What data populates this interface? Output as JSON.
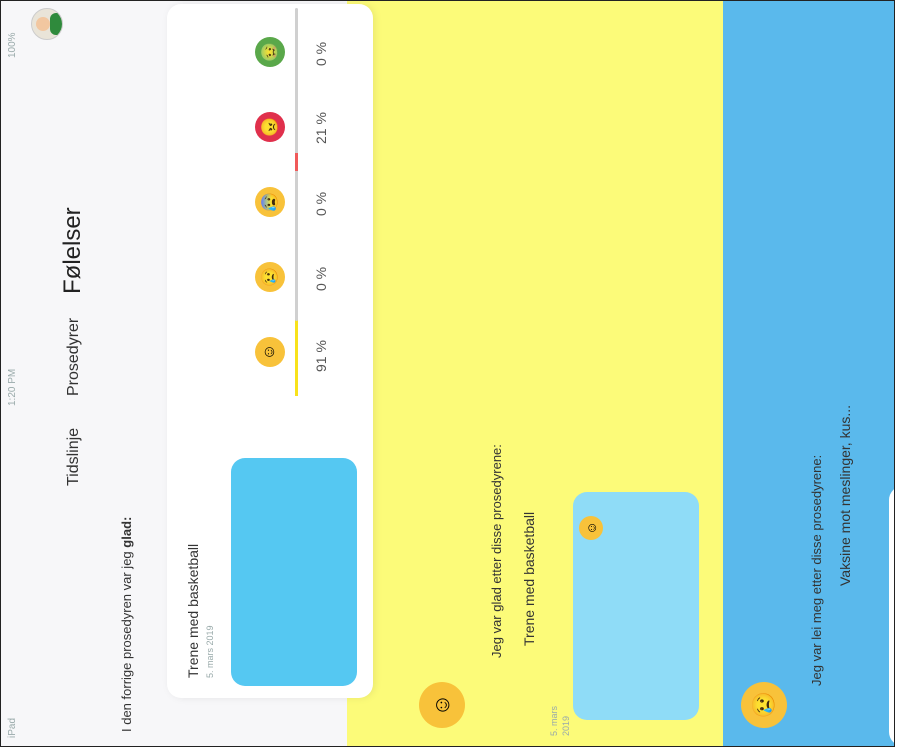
{
  "statusbar": {
    "device": "iPad",
    "time": "1:20 PM",
    "battery": "100%"
  },
  "nav": {
    "tabs": [
      "Tidslinje",
      "Prosedyrer",
      "Følelser"
    ],
    "active": "Følelser"
  },
  "summary": {
    "intro_prefix": "I den forrige prosedyren var jeg ",
    "intro_emphasis": "glad:",
    "moods": [
      {
        "icon": "happy-face-icon",
        "percent": "91 %",
        "value": 0.91,
        "color": "#f8e21b"
      },
      {
        "icon": "crying-face-icon",
        "percent": "0 %",
        "value": 0.0,
        "color": "#cfcfcf"
      },
      {
        "icon": "scared-face-icon",
        "percent": "0 %",
        "value": 0.0,
        "color": "#cfcfcf"
      },
      {
        "icon": "angry-face-icon",
        "percent": "21 %",
        "value": 0.21,
        "color": "#f05a5a"
      },
      {
        "icon": "sick-face-icon",
        "percent": "0 %",
        "value": 0.0,
        "color": "#cfcfcf"
      }
    ],
    "procedure": {
      "title": "Trene med basketball",
      "date": "5. mars 2019"
    }
  },
  "sections": [
    {
      "mood": "happy-face-icon",
      "heading": "Jeg var glad etter disse prosedyrene:",
      "procedure": {
        "title": "Trene med basketball",
        "date_line1": "5. mars",
        "date_line2": "2019"
      }
    },
    {
      "mood": "crying-face-icon",
      "heading": "Jeg var lei meg etter disse prosedyrene:",
      "procedure": {
        "title": "Vaksine mot meslinger, kus...",
        "date_line1": "",
        "date_line2": ""
      }
    }
  ],
  "colors": {
    "yellow": "#fcfb79",
    "blue": "#5ab9ec",
    "light_blue": "#8fdcf7",
    "chip_blue": "#55c8f2"
  }
}
